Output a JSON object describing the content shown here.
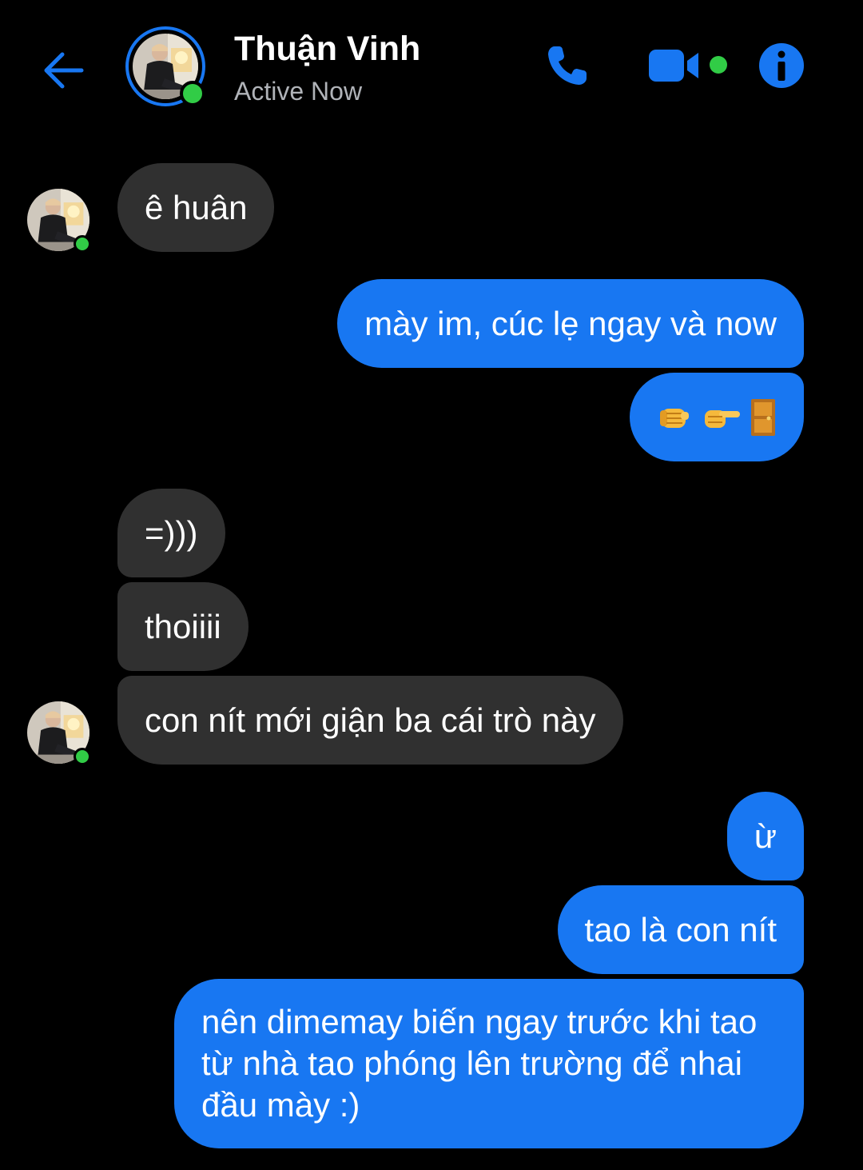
{
  "header": {
    "name": "Thuận Vinh",
    "status": "Active Now",
    "back_icon": "arrow-left-icon",
    "call_icon": "phone-icon",
    "video_icon": "video-camera-icon",
    "info_icon": "info-icon",
    "active_color": "#31cc46",
    "accent_color": "#1877f2"
  },
  "messages": [
    {
      "sender": "contact",
      "text": "ê huân"
    },
    {
      "sender": "me",
      "text": "mày im, cúc lẹ ngay và now"
    },
    {
      "sender": "me",
      "emoji": [
        "oncoming-fist-icon",
        "pointing-right-icon",
        "door-icon"
      ]
    },
    {
      "sender": "contact",
      "text": "=)))"
    },
    {
      "sender": "contact",
      "text": "thoiiii"
    },
    {
      "sender": "contact",
      "text": "con nít mới giận ba cái trò này"
    },
    {
      "sender": "me",
      "text": "ừ"
    },
    {
      "sender": "me",
      "text": "tao là con nít"
    },
    {
      "sender": "me",
      "text": "nên dimemay biến ngay trước khi tao từ nhà tao phóng lên trường để nhai đầu mày :)"
    }
  ],
  "colors": {
    "incoming_bubble": "#303030",
    "outgoing_bubble": "#1877f2",
    "background": "#000000",
    "status_text": "#b0b3b8"
  }
}
